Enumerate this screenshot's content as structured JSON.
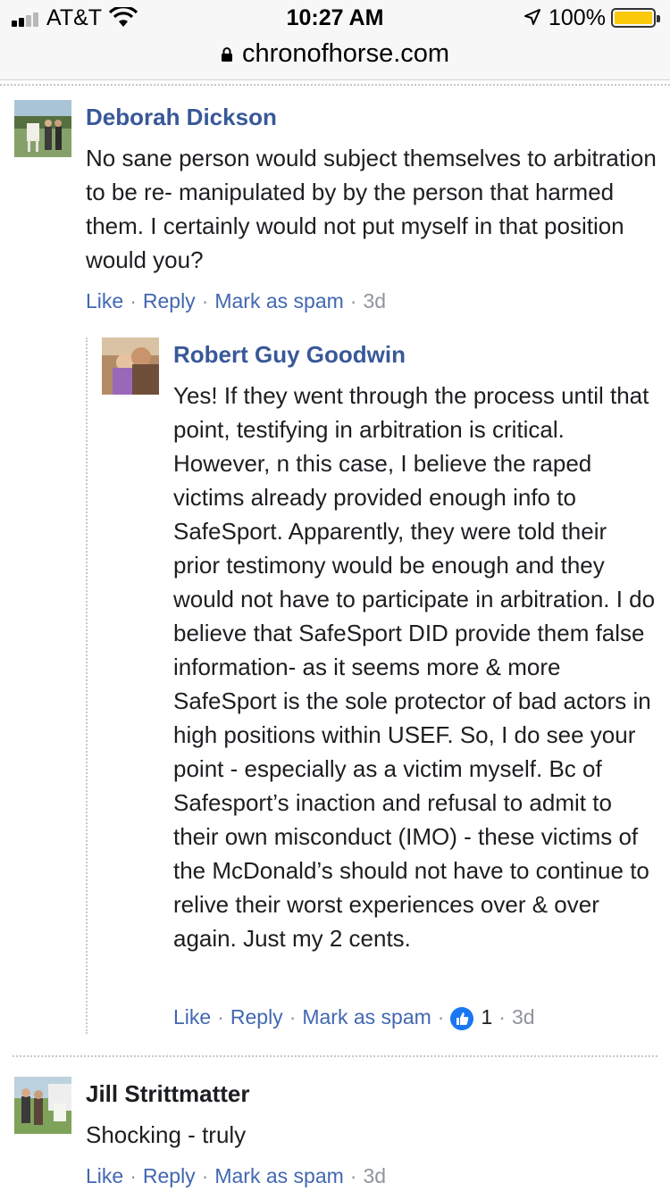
{
  "status_bar": {
    "carrier": "AT&T",
    "time": "10:27 AM",
    "battery": "100%"
  },
  "address_bar": {
    "url": "chronofhorse.com"
  },
  "comments": [
    {
      "author": "Deborah Dickson",
      "text": "No sane person would subject themselves to arbitration to be re- manipulated by by the person that harmed them. I certainly would not put myself in that position would you?",
      "actions": {
        "like": "Like",
        "reply": "Reply",
        "spam": "Mark as spam",
        "time": "3d"
      }
    },
    {
      "author": "Robert Guy Goodwin",
      "text": "Yes! If they went through the process until that point, testifying in arbitration is critical. However, n this case, I believe the raped victims already provided enough info to SafeSport. Apparently, they were told their prior testimony would be enough and they would not have to participate in arbitration. I do believe that SafeSport DID provide them false information- as it seems more & more SafeSport is the sole protector of bad actors in high positions within USEF. So, I do see your point - especially as a victim myself. Bc of Safesport’s inaction and refusal to admit to their own misconduct (IMO) - these victims of the McDonald’s should not have to continue to relive their worst experiences over & over again. Just my 2 cents.",
      "actions": {
        "like": "Like",
        "reply": "Reply",
        "spam": "Mark as spam",
        "reaction_count": "1",
        "time": "3d"
      }
    },
    {
      "author": "Jill Strittmatter",
      "text": "Shocking - truly",
      "actions": {
        "like": "Like",
        "reply": "Reply",
        "spam": "Mark as spam",
        "time": "3d"
      }
    }
  ],
  "colors": {
    "link": "#4267b2",
    "author_link": "#385898",
    "muted": "#90949c",
    "battery": "#f9c90a",
    "like_badge": "#1877f2"
  },
  "icons": [
    "signal-icon",
    "wifi-icon",
    "location-icon",
    "battery-icon",
    "lock-icon",
    "like-reaction-icon"
  ]
}
